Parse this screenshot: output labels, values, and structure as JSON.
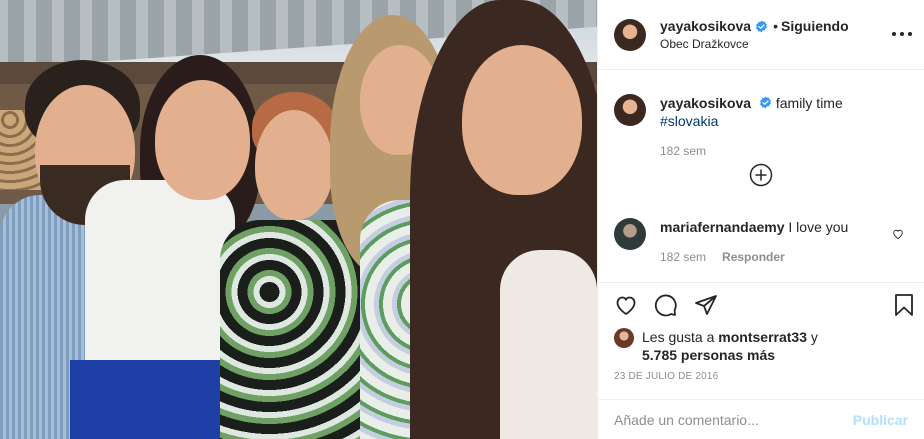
{
  "header": {
    "username": "yayakosikova",
    "separator": "•",
    "follow_status": "Siguiendo",
    "location": "Obec Dražkovce"
  },
  "caption": {
    "username": "yayakosikova",
    "text": "family time ",
    "hashtag": "#slovakia",
    "age": "182 sem"
  },
  "comments": [
    {
      "username": "mariafernandaemy",
      "text": "I love you",
      "age": "182 sem",
      "reply_label": "Responder"
    }
  ],
  "likes": {
    "prefix": "Les gusta a ",
    "user": "montserrat33",
    "connector": " y",
    "count": "5.785 personas más"
  },
  "date": "23 DE JULIO DE 2016",
  "composer": {
    "placeholder": "Añade un comentario...",
    "post_label": "Publicar"
  },
  "colors": {
    "verified": "#3897f0",
    "hashtag": "#00376b",
    "publish_disabled": "#b2dffc",
    "secondary_text": "#8e8e8e"
  },
  "icons": {
    "like": "heart-icon",
    "comment": "comment-icon",
    "share": "share-icon",
    "save": "bookmark-icon",
    "load_more": "plus-circle-icon",
    "more": "more-options-icon"
  }
}
